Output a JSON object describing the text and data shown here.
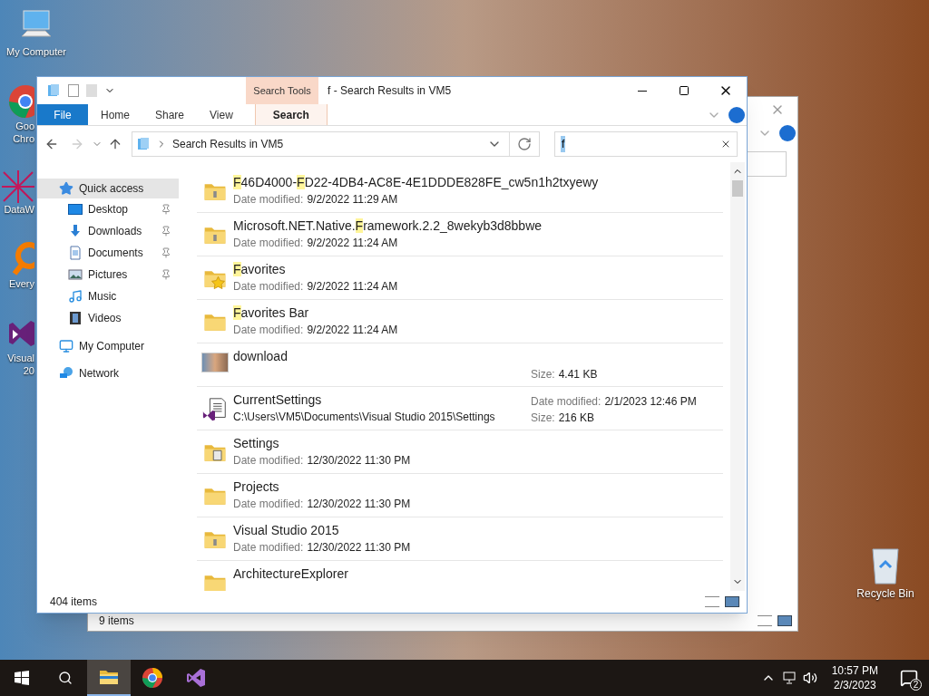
{
  "desktop_icons": [
    {
      "kind": "computer",
      "lines": [
        "My Computer"
      ]
    },
    {
      "kind": "chrome",
      "lines": [
        "Goo",
        "Chro"
      ]
    },
    {
      "kind": "datawarrior",
      "lines": [
        "DataW"
      ]
    },
    {
      "kind": "everything",
      "lines": [
        "Every"
      ]
    },
    {
      "kind": "visualstudio",
      "lines": [
        "Visual",
        "20"
      ]
    }
  ],
  "recycle_bin": {
    "label": "Recycle Bin"
  },
  "back_window": {
    "status": "9 items"
  },
  "window": {
    "title": "f - Search Results in VM5",
    "tab_group": "Search Tools",
    "tabs": [
      {
        "label": "File",
        "kind": "file",
        "selected": false
      },
      {
        "label": "Home",
        "kind": "plain",
        "selected": false
      },
      {
        "label": "Share",
        "kind": "plain",
        "selected": false
      },
      {
        "label": "View",
        "kind": "plain",
        "selected": false
      },
      {
        "label": "Search",
        "kind": "contextual",
        "selected": true
      }
    ],
    "address": {
      "path": "Search Results in VM5"
    },
    "search": {
      "value": "f",
      "text_selected": true
    },
    "nav_pane": [
      {
        "label": "Quick access",
        "kind": "star",
        "selected": true,
        "children": [
          {
            "label": "Desktop",
            "kind": "desktop",
            "pinned": true,
            "selected": false
          },
          {
            "label": "Downloads",
            "kind": "downloads",
            "pinned": true,
            "selected": false
          },
          {
            "label": "Documents",
            "kind": "documents",
            "pinned": true,
            "selected": false
          },
          {
            "label": "Pictures",
            "kind": "pictures",
            "pinned": true,
            "selected": false
          },
          {
            "label": "Music",
            "kind": "music",
            "pinned": false,
            "selected": false
          },
          {
            "label": "Videos",
            "kind": "videos",
            "pinned": false,
            "selected": false
          }
        ]
      },
      {
        "label": "My Computer",
        "kind": "computer",
        "selected": false
      },
      {
        "label": "Network",
        "kind": "network",
        "selected": false
      }
    ],
    "results": [
      {
        "kind": "zip-folder",
        "name": [
          {
            "text": "F",
            "match": true
          },
          {
            "text": "46D4000-",
            "match": false
          },
          {
            "text": "F",
            "match": true
          },
          {
            "text": "D22-4DB4-AC8E-4E1DDDE828FE_cw5n1h2txyewy",
            "match": false
          }
        ],
        "details": [
          {
            "label": "Date modified:",
            "value": "9/2/2022 11:29 AM"
          }
        ]
      },
      {
        "kind": "zip-folder",
        "name": [
          {
            "text": "Microsoft.NET.Native.",
            "match": false
          },
          {
            "text": "F",
            "match": true
          },
          {
            "text": "ramework.2.2_8wekyb3d8bbwe",
            "match": false
          }
        ],
        "details": [
          {
            "label": "Date modified:",
            "value": "9/2/2022 11:24 AM"
          }
        ]
      },
      {
        "kind": "star-folder",
        "name": [
          {
            "text": "F",
            "match": true
          },
          {
            "text": "avorites",
            "match": false
          }
        ],
        "details": [
          {
            "label": "Date modified:",
            "value": "9/2/2022 11:24 AM"
          }
        ]
      },
      {
        "kind": "folder",
        "name": [
          {
            "text": "F",
            "match": true
          },
          {
            "text": "avorites Bar",
            "match": false
          }
        ],
        "details": [
          {
            "label": "Date modified:",
            "value": "9/2/2022 11:24 AM"
          }
        ]
      },
      {
        "kind": "image",
        "name": [
          {
            "text": "download",
            "match": false
          }
        ],
        "side_details": [
          {
            "label": "Size:",
            "value": "4.41 KB"
          }
        ]
      },
      {
        "kind": "vs-settings",
        "name": [
          {
            "text": "CurrentSettings",
            "match": false
          }
        ],
        "path": "C:\\Users\\VM5\\Documents\\Visual Studio 2015\\Settings",
        "side_details": [
          {
            "label": "Date modified:",
            "value": "2/1/2023 12:46 PM"
          },
          {
            "label": "Size:",
            "value": "216 KB"
          }
        ]
      },
      {
        "kind": "settings-folder",
        "name": [
          {
            "text": "Settings",
            "match": false
          }
        ],
        "details": [
          {
            "label": "Date modified:",
            "value": "12/30/2022 11:30 PM"
          }
        ]
      },
      {
        "kind": "folder",
        "name": [
          {
            "text": "Projects",
            "match": false
          }
        ],
        "details": [
          {
            "label": "Date modified:",
            "value": "12/30/2022 11:30 PM"
          }
        ]
      },
      {
        "kind": "zip-folder",
        "name": [
          {
            "text": "Visual Studio 2015",
            "match": false
          }
        ],
        "details": [
          {
            "label": "Date modified:",
            "value": "12/30/2022 11:30 PM"
          }
        ]
      },
      {
        "kind": "folder",
        "name": [
          {
            "text": "ArchitectureExplorer",
            "match": false
          }
        ]
      }
    ],
    "status": "404 items"
  },
  "taskbar": {
    "apps": [
      {
        "kind": "explorer",
        "active": true
      },
      {
        "kind": "chrome",
        "active": false
      },
      {
        "kind": "visualstudio",
        "active": false
      }
    ],
    "time": "10:57 PM",
    "date": "2/3/2023",
    "notifications": "2"
  }
}
